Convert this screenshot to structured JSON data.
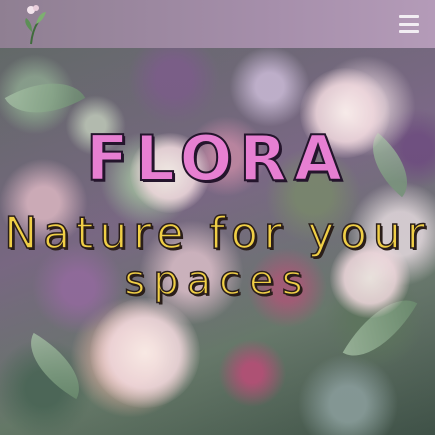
{
  "header": {
    "logo_icon": "leaf-sprout-icon",
    "menu_icon": "hamburger-menu-icon",
    "background_color": "#a58eaa"
  },
  "hero": {
    "title": "FLORA",
    "subtitle_line1": "Nature for your",
    "subtitle_line2": "spaces",
    "title_color": "#e77fd2",
    "subtitle_color": "#f0cf46"
  }
}
